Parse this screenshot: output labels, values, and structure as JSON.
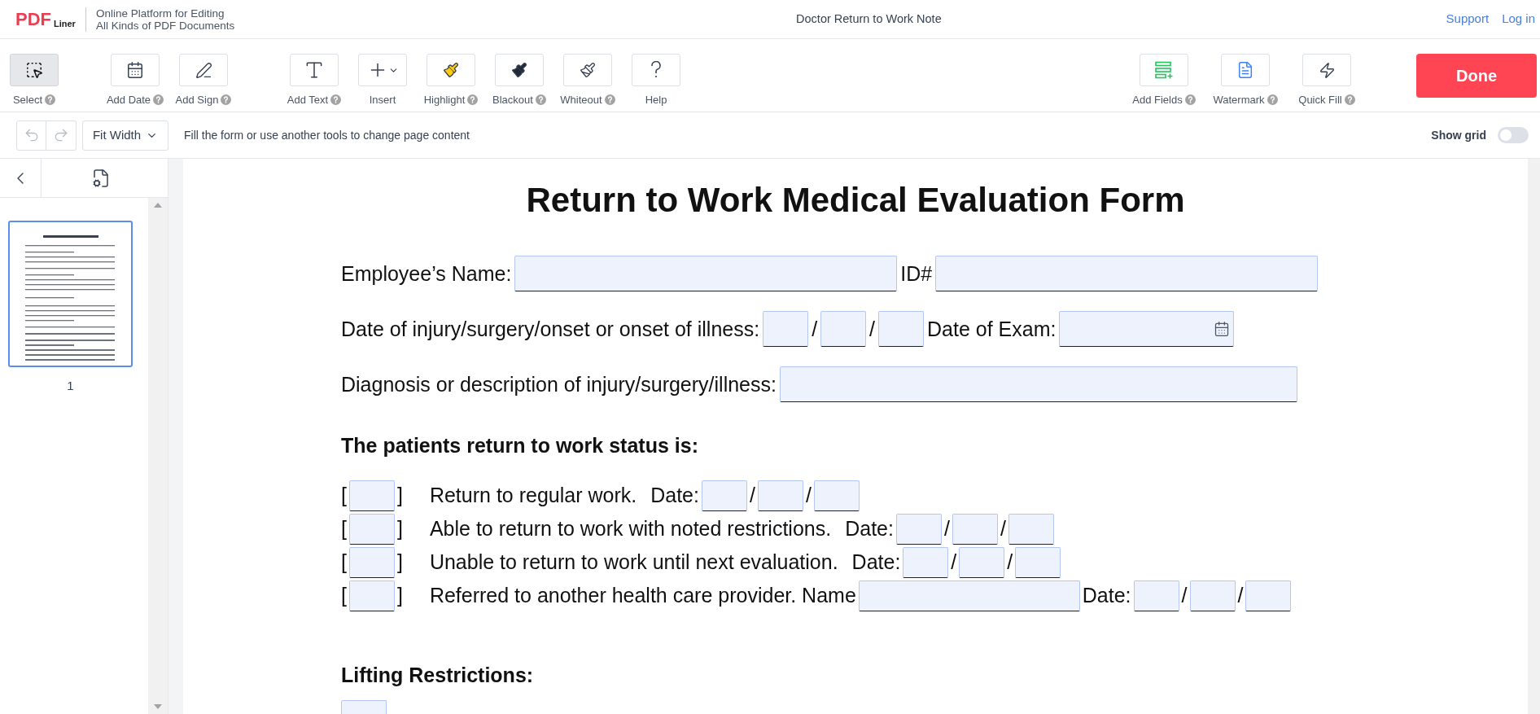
{
  "header": {
    "logo": {
      "mark": "PDF",
      "sub": "Liner"
    },
    "tagline": [
      "Online Platform for Editing",
      "All Kinds of PDF Documents"
    ],
    "title": "Doctor Return to Work Note",
    "links": [
      "Support",
      "Log in"
    ]
  },
  "toolbar": {
    "tool_groups": [
      [
        {
          "kind": "select",
          "label": "Select",
          "help": true,
          "selected": true
        }
      ],
      [
        {
          "kind": "date",
          "label": "Add Date",
          "help": true,
          "selected": false
        },
        {
          "kind": "sign",
          "label": "Add Sign",
          "help": true,
          "selected": false
        }
      ],
      [
        {
          "kind": "text",
          "label": "Add Text",
          "help": true,
          "selected": false
        },
        {
          "kind": "insert",
          "label": "Insert",
          "help": false,
          "selected": false
        },
        {
          "kind": "highlight",
          "label": "Highlight",
          "help": true,
          "selected": false
        },
        {
          "kind": "blackout",
          "label": "Blackout",
          "help": true,
          "selected": false
        },
        {
          "kind": "whiteout",
          "label": "Whiteout",
          "help": true,
          "selected": false
        },
        {
          "kind": "help",
          "label": "Help",
          "help": false,
          "selected": false
        }
      ]
    ],
    "right_tools": [
      {
        "kind": "fields",
        "label": "Add Fields",
        "help": true,
        "selected": false
      },
      {
        "kind": "watermark",
        "label": "Watermark",
        "help": true,
        "selected": false
      },
      {
        "kind": "quickfill",
        "label": "Quick Fill",
        "help": true,
        "selected": false
      }
    ],
    "done": "Done"
  },
  "subbar": {
    "undo": {
      "disabled": true
    },
    "redo": {
      "disabled": true
    },
    "zoom": "Fit Width",
    "hint": "Fill the form or use another tools to change page content",
    "show_grid": {
      "label": "Show grid",
      "on": false
    }
  },
  "sidebar": {
    "pages": [
      {
        "number": "1",
        "selected": true
      }
    ]
  },
  "form": {
    "title": "Return to Work Medical Evaluation Form",
    "lines": [
      {
        "kind": "field_row",
        "segments": [
          {
            "kind": "text",
            "text": "Employee’s Name:"
          },
          {
            "kind": "wide_field"
          },
          {
            "kind": "text",
            "text": "ID#"
          },
          {
            "kind": "wide_field"
          }
        ]
      },
      {
        "kind": "field_row",
        "segments": [
          {
            "kind": "text",
            "text": "Date of injury/surgery/onset or onset of illness:"
          },
          {
            "kind": "date_part"
          },
          {
            "kind": "text",
            "text": "/"
          },
          {
            "kind": "date_part"
          },
          {
            "kind": "text",
            "text": "/"
          },
          {
            "kind": "date_part"
          },
          {
            "kind": "text",
            "text": "Date of Exam:"
          },
          {
            "kind": "date_field"
          }
        ]
      },
      {
        "kind": "field_row",
        "segments": [
          {
            "kind": "text",
            "text": "Diagnosis or description of injury/surgery/illness:"
          },
          {
            "kind": "full_field"
          }
        ]
      },
      {
        "kind": "heading",
        "segments": [
          {
            "kind": "bold",
            "text": "The patients return to work status is:"
          }
        ]
      },
      {
        "kind": "check_row",
        "segments": [
          {
            "kind": "bracket",
            "text": "["
          },
          {
            "kind": "check_box"
          },
          {
            "kind": "bracket",
            "text": "]"
          },
          {
            "kind": "text",
            "text": "Return to regular work."
          },
          {
            "kind": "text",
            "text": "Date:"
          },
          {
            "kind": "date_part"
          },
          {
            "kind": "text",
            "text": "/"
          },
          {
            "kind": "date_part"
          },
          {
            "kind": "text",
            "text": "/"
          },
          {
            "kind": "date_part"
          }
        ]
      },
      {
        "kind": "check_row",
        "segments": [
          {
            "kind": "bracket",
            "text": "["
          },
          {
            "kind": "check_box"
          },
          {
            "kind": "bracket",
            "text": "]"
          },
          {
            "kind": "text",
            "text": "Able to return to work with noted restrictions."
          },
          {
            "kind": "text",
            "text": "Date:"
          },
          {
            "kind": "date_part"
          },
          {
            "kind": "text",
            "text": "/"
          },
          {
            "kind": "date_part"
          },
          {
            "kind": "text",
            "text": "/"
          },
          {
            "kind": "date_part"
          }
        ]
      },
      {
        "kind": "check_row",
        "segments": [
          {
            "kind": "bracket",
            "text": "["
          },
          {
            "kind": "check_box"
          },
          {
            "kind": "bracket",
            "text": "]"
          },
          {
            "kind": "text",
            "text": "Unable to return to work until next evaluation."
          },
          {
            "kind": "text",
            "text": "Date:"
          },
          {
            "kind": "date_part"
          },
          {
            "kind": "text",
            "text": "/"
          },
          {
            "kind": "date_part"
          },
          {
            "kind": "text",
            "text": "/"
          },
          {
            "kind": "date_part"
          }
        ]
      },
      {
        "kind": "check_row",
        "segments": [
          {
            "kind": "bracket",
            "text": "["
          },
          {
            "kind": "check_box"
          },
          {
            "kind": "bracket",
            "text": "]"
          },
          {
            "kind": "text",
            "text": "Referred to another health care provider. Name"
          },
          {
            "kind": "name_field"
          },
          {
            "kind": "text",
            "text": "Date:"
          },
          {
            "kind": "date_part"
          },
          {
            "kind": "text",
            "text": "/"
          },
          {
            "kind": "date_part"
          },
          {
            "kind": "text",
            "text": "/"
          },
          {
            "kind": "date_part"
          }
        ]
      },
      {
        "kind": "heading",
        "segments": [
          {
            "kind": "bold",
            "text": "Lifting Restrictions:"
          }
        ]
      },
      {
        "kind": "partial_row",
        "segments": [
          {
            "kind": "check_box"
          }
        ]
      }
    ]
  }
}
